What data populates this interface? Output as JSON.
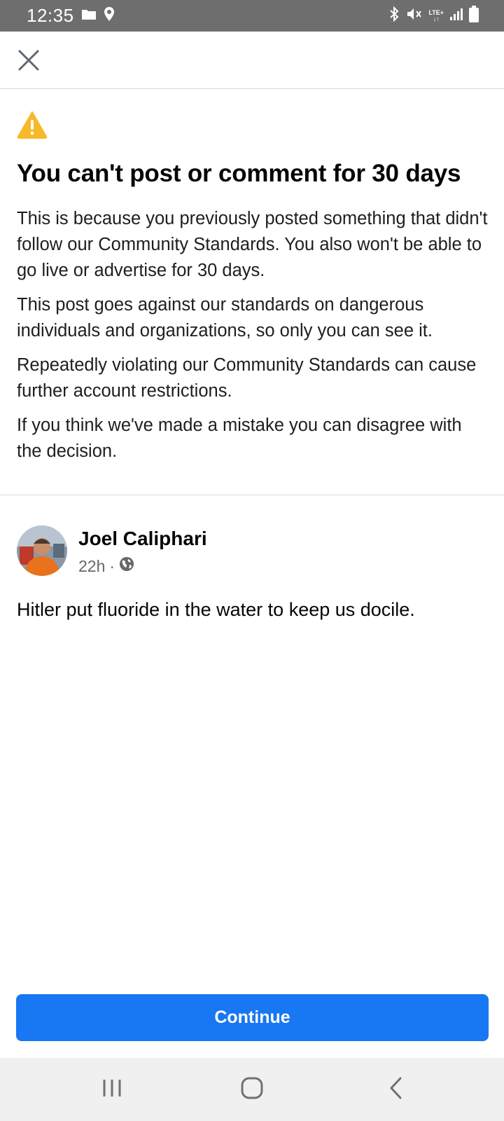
{
  "status_bar": {
    "time": "12:35",
    "network_label": "LTE+",
    "icons": [
      "folder-icon",
      "location-icon",
      "bluetooth-icon",
      "mute-icon",
      "signal-icon",
      "battery-icon"
    ]
  },
  "header": {
    "close_icon": "close-icon"
  },
  "notice": {
    "icon": "warning-icon",
    "icon_color": "#F7B928",
    "title": "You can't post or comment for 30 days",
    "paragraphs": [
      "This is because you previously posted something that didn't follow our Community Standards. You also won't be able to go live or advertise for 30 days.",
      "This post goes against our standards on dangerous individuals and organizations, so only you can see it.",
      "Repeatedly violating our Community Standards can cause further account restrictions.",
      "If you think we've made a mistake you can disagree with the decision."
    ]
  },
  "post": {
    "author": "Joel Caliphari",
    "time": "22h",
    "separator": "·",
    "audience_icon": "globe-icon",
    "text": "Hitler put fluoride in the water to keep us docile."
  },
  "footer": {
    "continue_label": "Continue",
    "button_color": "#1877F2"
  },
  "nav_bar": {
    "buttons": [
      "recents-icon",
      "home-icon",
      "back-icon"
    ]
  }
}
